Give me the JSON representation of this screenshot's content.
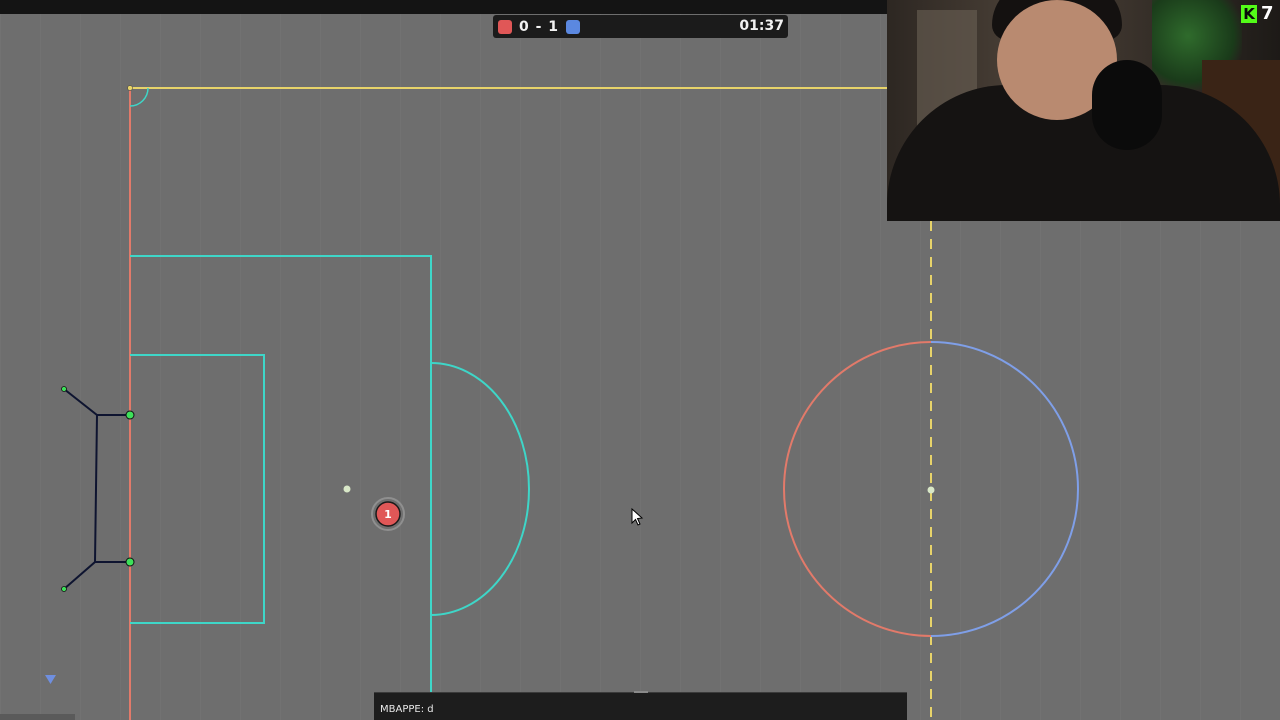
{
  "scoreboard": {
    "red_color": "#e05757",
    "blue_color": "#5b88e0",
    "score": "0 - 1",
    "timer": "01:37"
  },
  "player": {
    "avatar": "1",
    "team_color": "#e05757"
  },
  "chat": {
    "input_value": "MBAPPE: d"
  },
  "stream_overlay": {
    "kick_count": "7",
    "kick_letter": "K",
    "kick_color": "#53fc18"
  },
  "colors": {
    "pitch": "#6f6f6f",
    "box_lines": "#3ed6c8",
    "top_line": "#e7d36a",
    "goal_line": "#e27a6a",
    "center_left_arc": "#e27a6a",
    "center_right_arc": "#7f9fe8",
    "midline": "#e7d36a",
    "goal_net": "#0e1430"
  }
}
